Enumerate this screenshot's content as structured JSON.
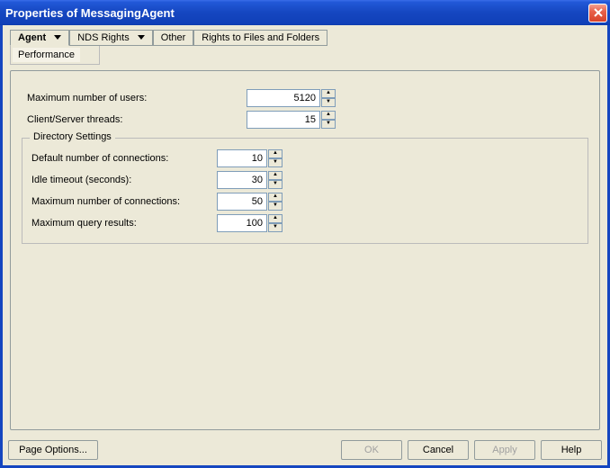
{
  "title": "Properties of MessagingAgent",
  "tabs": {
    "agent": "Agent",
    "nds": "NDS Rights",
    "other": "Other",
    "rights": "Rights to Files and Folders"
  },
  "subtab": "Performance",
  "form": {
    "max_users_label": "Maximum number of users:",
    "max_users_value": "5120",
    "threads_label": "Client/Server threads:",
    "threads_value": "15"
  },
  "dir": {
    "legend": "Directory Settings",
    "def_conn_label": "Default number of connections:",
    "def_conn_value": "10",
    "idle_label": "Idle timeout (seconds):",
    "idle_value": "30",
    "max_conn_label": "Maximum number of connections:",
    "max_conn_value": "50",
    "max_query_label": "Maximum query results:",
    "max_query_value": "100"
  },
  "buttons": {
    "page_options": "Page Options...",
    "ok": "OK",
    "cancel": "Cancel",
    "apply": "Apply",
    "help": "Help"
  }
}
